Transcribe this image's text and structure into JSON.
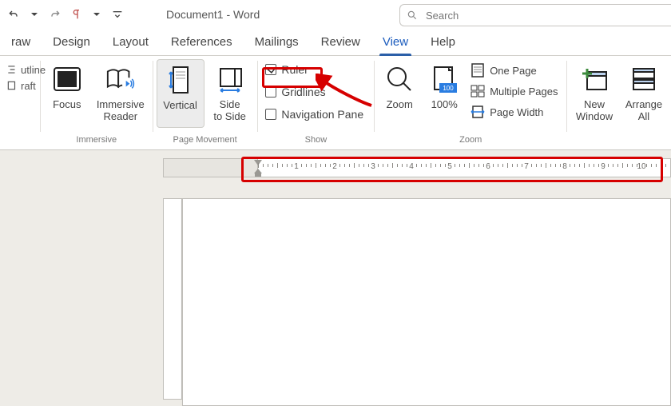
{
  "title": "Document1  -  Word",
  "search": {
    "placeholder": "Search"
  },
  "tabs": [
    "raw",
    "Design",
    "Layout",
    "References",
    "Mailings",
    "Review",
    "View",
    "Help"
  ],
  "active_tab": "View",
  "views_column": {
    "outline": "utline",
    "draft": "raft"
  },
  "immersive": {
    "focus": "Focus",
    "reader": "Immersive\nReader",
    "group": "Immersive"
  },
  "page_movement": {
    "vertical": "Vertical",
    "side": "Side\nto Side",
    "group": "Page Movement"
  },
  "show": {
    "ruler": "Ruler",
    "ruler_checked": true,
    "gridlines": "Gridlines",
    "gridlines_checked": false,
    "nav": "Navigation Pane",
    "nav_checked": false,
    "group": "Show"
  },
  "zoom": {
    "zoom": "Zoom",
    "hundred": "100%",
    "one_page": "One Page",
    "multi": "Multiple Pages",
    "width": "Page Width",
    "group": "Zoom"
  },
  "window": {
    "new": "New\nWindow",
    "arrange": "Arrange\nAll"
  },
  "ruler": {
    "min": 0,
    "max": 11,
    "major_every": 1
  }
}
